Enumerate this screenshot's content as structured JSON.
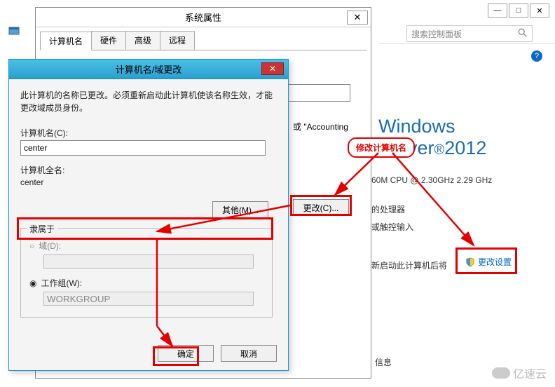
{
  "topControls": {
    "minimize": "—",
    "maximize": "□",
    "close": "✕"
  },
  "search": {
    "placeholder": "搜索控制面板"
  },
  "backgroundPanel": {
    "brand": "Windows Server",
    "brandYear": "2012",
    "cpu": "60M CPU @ 2.30GHz  2.29 GHz",
    "processor": "的处理器",
    "touch": "或触控输入",
    "restartNote": "新启动此计算机后将",
    "changeSettings": "更改设置",
    "msg": "信息"
  },
  "sysprops": {
    "title": "系统属性",
    "tabs": [
      "计算机名",
      "硬件",
      "高级",
      "远程"
    ],
    "descInputValue": "",
    "accounting": "或 \"Accounting",
    "changeBtn": "更改(C)..."
  },
  "renameDialog": {
    "title": "计算机名/域更改",
    "message": "此计算机的名称已更改。必须重新启动此计算机使该名称生效，才能更改域成员身份。",
    "computerNameLabel": "计算机名(C):",
    "computerNameValue": "center",
    "fullNameLabel": "计算机全名:",
    "fullNameValue": "center",
    "otherBtn": "其他(M)...",
    "membershipLegend": "隶属于",
    "domainLabel": "域(D):",
    "domainValue": "",
    "workgroupLabel": "工作组(W):",
    "workgroupValue": "WORKGROUP",
    "okBtn": "确定",
    "cancelBtn": "取消"
  },
  "annotations": {
    "callout": "修改计算机名"
  },
  "watermark": "亿速云"
}
